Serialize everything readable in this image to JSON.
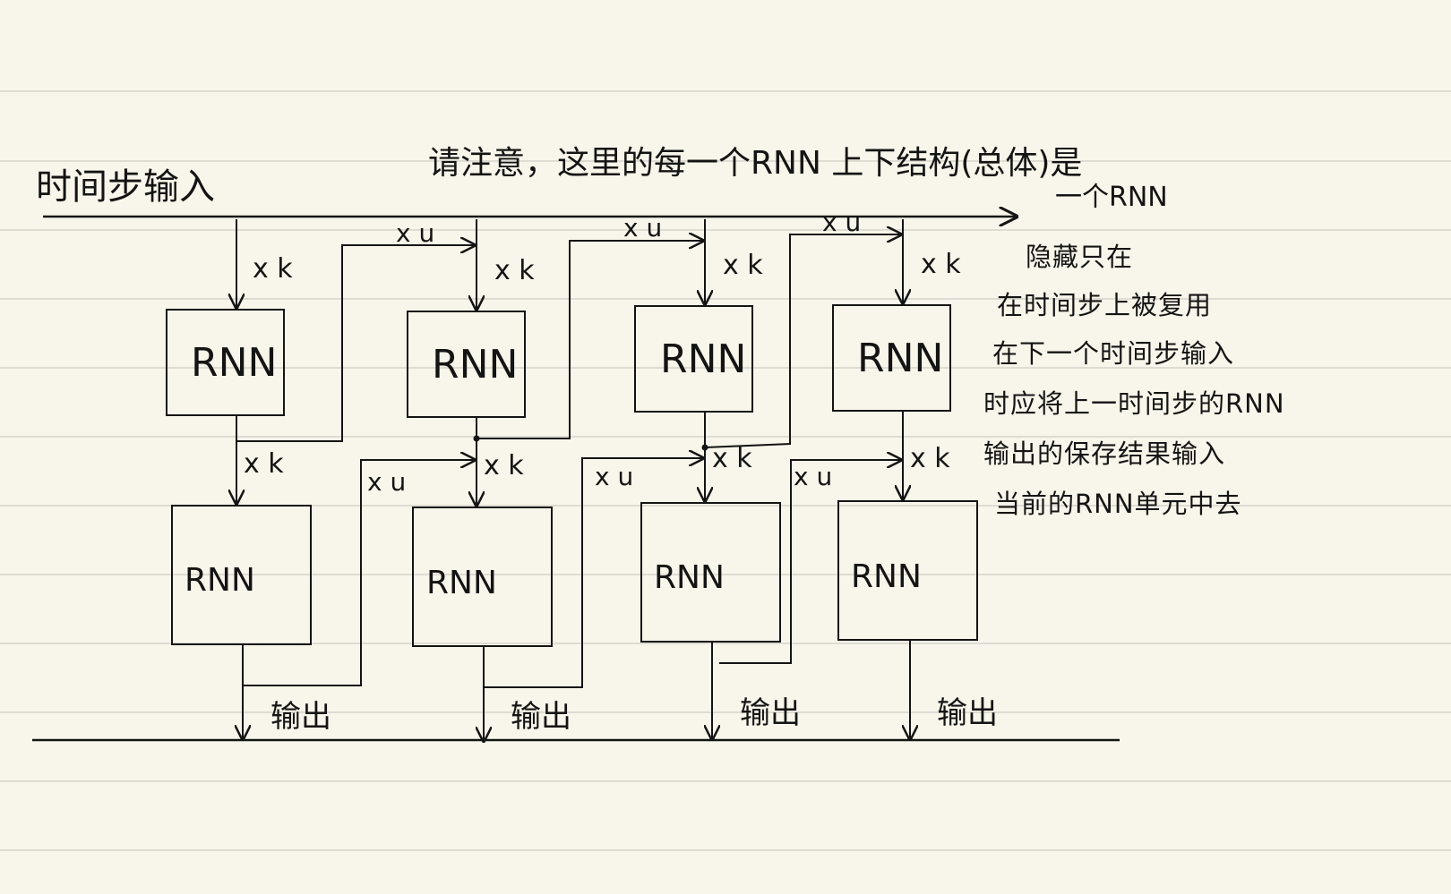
{
  "title_left": "时间步输入",
  "title_note": "请注意，这里的每一个RNN 上下结构(总体)是",
  "title_note_cont": "一个RNN",
  "side_note": [
    "隐藏只在",
    "在时间步上被复用",
    "在下一个时间步输入",
    "时应将上一时间步的RNN",
    "输出的保存结果输入",
    "当前的RNN单元中去"
  ],
  "cell_label": "RNN",
  "weight_k": "x k",
  "weight_u": "x u",
  "output_label": "输出",
  "colors": {
    "ink": "#141414",
    "paper": "#f8f6ea",
    "rule": "#dedcd3"
  }
}
